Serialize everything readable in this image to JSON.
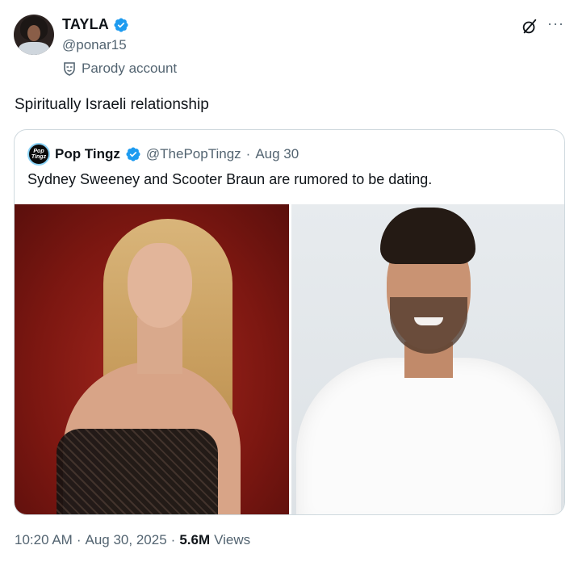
{
  "author": {
    "display_name": "TAYLA",
    "handle": "@ponar15",
    "label": "Parody account",
    "verified_color": "#1d9bf0"
  },
  "tweet": {
    "text": "Spiritually Israeli relationship"
  },
  "quoted": {
    "display_name": "Pop Tingz",
    "avatar_text": "Pop Tingz",
    "handle": "@ThePopTingz",
    "separator": "·",
    "date": "Aug 30",
    "text": "Sydney Sweeney and Scooter Braun are rumored to be dating."
  },
  "footer": {
    "time": "10:20 AM",
    "sep1": "·",
    "date": "Aug 30, 2025",
    "sep2": "·",
    "views_count": "5.6M",
    "views_label": "Views"
  },
  "icons": {
    "more": "···",
    "grok": "grok-icon",
    "verified": "verified-badge-icon",
    "parody": "parody-mask-icon"
  }
}
